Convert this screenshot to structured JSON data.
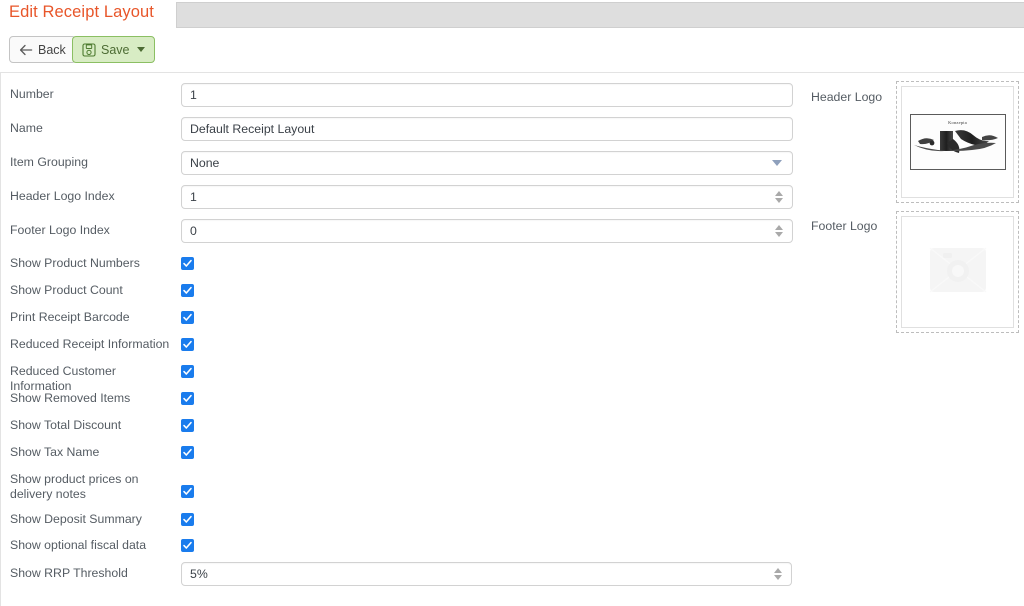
{
  "window": {
    "title": "Edit Receipt Layout",
    "title_color": "#e8562a",
    "tabstrip_color": "#dedede"
  },
  "toolbar": {
    "back_label": "Back",
    "back_icon": "arrow-left-icon",
    "save_label": "Save",
    "save_icon": "floppy-disk-icon",
    "save_has_dropdown": true
  },
  "form": {
    "fields": [
      {
        "label": "Number",
        "type": "text",
        "value": "1"
      },
      {
        "label": "Name",
        "type": "text",
        "value": "Default Receipt Layout"
      },
      {
        "label": "Item Grouping",
        "type": "select",
        "value": "None"
      },
      {
        "label": "Header Logo Index",
        "type": "number",
        "value": "1"
      },
      {
        "label": "Footer Logo Index",
        "type": "number",
        "value": "0"
      }
    ],
    "checkboxes": [
      {
        "label": "Show Product Numbers",
        "checked": true
      },
      {
        "label": "Show Product Count",
        "checked": true
      },
      {
        "label": "Print Receipt Barcode",
        "checked": true
      },
      {
        "label": "Reduced Receipt Information",
        "checked": true
      },
      {
        "label": "Reduced Customer Information",
        "checked": true
      },
      {
        "label": "Show Removed Items",
        "checked": true
      },
      {
        "label": "Show Total Discount",
        "checked": true
      },
      {
        "label": "Show Tax Name",
        "checked": true
      },
      {
        "label": "Show product prices on delivery notes",
        "checked": true
      },
      {
        "label": "Show Deposit Summary",
        "checked": true
      },
      {
        "label": "Show optional fiscal data",
        "checked": true
      }
    ],
    "threshold": {
      "label": "Show RRP Threshold",
      "value": "5%",
      "type": "number"
    }
  },
  "logos": {
    "header": {
      "label": "Header Logo",
      "has_image": true,
      "image_caption": "Konzepta"
    },
    "footer": {
      "label": "Footer Logo",
      "has_image": false,
      "placeholder_icon": "image-placeholder-icon"
    }
  },
  "colors": {
    "accent": "#e8562a",
    "checkbox": "#1a7ced",
    "save_bg": "#d8ecc4",
    "save_border": "#8bbf63"
  }
}
